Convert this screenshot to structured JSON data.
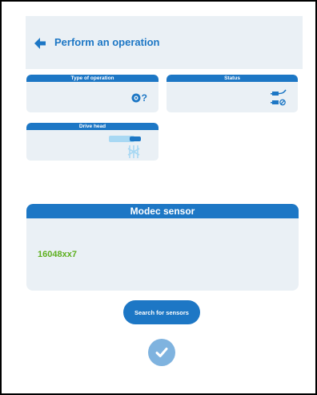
{
  "header": {
    "title": "Perform an operation"
  },
  "cards": {
    "type_of_operation": {
      "label": "Type of operation",
      "icon": "operation-unknown-icon",
      "suffix": "?"
    },
    "status": {
      "label": "Status",
      "icon": "connection-status-icon"
    },
    "drive_head": {
      "label": "Drive head",
      "icon": "drive-head-icon"
    }
  },
  "sensor": {
    "title": "Modec sensor",
    "value": "16048xx7"
  },
  "actions": {
    "search_label": "Search for sensors",
    "confirm_icon": "check-icon"
  },
  "colors": {
    "primary": "#1d77c5",
    "panel": "#eaf0f5",
    "accent_green": "#5fb021",
    "confirm": "#7fb3df"
  }
}
